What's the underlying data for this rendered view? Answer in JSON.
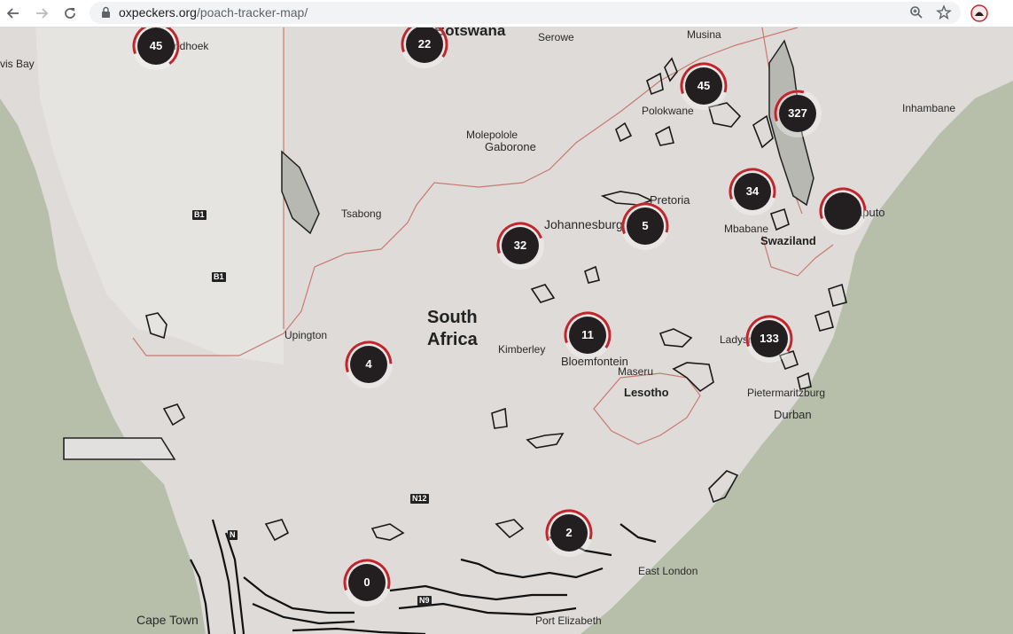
{
  "browser": {
    "url_domain": "oxpeckers.org",
    "url_path": "/poach-tracker-map/"
  },
  "map": {
    "colors": {
      "ocean": "#b7bfaa",
      "land": "#dedbd8",
      "land_light": "#eae8e6",
      "border": "#c87a72",
      "cluster_fill": "#231f20",
      "cluster_ring": "#c1262d"
    },
    "countries": [
      "South Africa",
      "Lesotho",
      "Swaziland"
    ],
    "cities": {
      "windhoek": "ndhoek",
      "walvis_bay": "vis Bay",
      "botswana": "Botswana",
      "serowe": "Serowe",
      "musina": "Musina",
      "polokwane": "Polokwane",
      "inhambane": "Inhambane",
      "molepolole": "Molepolole",
      "gaborone": "Gaborone",
      "tsabong": "Tsabong",
      "pretoria": "Pretoria",
      "johannesburg": "Johannesburg",
      "maputo": "aputo",
      "mbabane": "Mbabane",
      "upington": "Upington",
      "kimberley": "Kimberley",
      "bloemfontein": "Bloemfontein",
      "maseru": "Maseru",
      "ladysmith": "Ladysm",
      "pietermaritzburg": "Pietermaritzburg",
      "durban": "Durban",
      "east_london": "East London",
      "cape_town": "Cape Town",
      "port_elizabeth": "Port Elizabeth"
    },
    "roads": [
      "B1",
      "B1",
      "N12",
      "N",
      "N9"
    ],
    "clusters": [
      {
        "id": "windhoek",
        "count": "45",
        "progress": 0.7
      },
      {
        "id": "botswana",
        "count": "22",
        "progress": 0.65
      },
      {
        "id": "musina",
        "count": "45",
        "progress": 0.6
      },
      {
        "id": "kruger",
        "count": "327",
        "progress": 0.35
      },
      {
        "id": "mpumalanga",
        "count": "34",
        "progress": 0.6
      },
      {
        "id": "maputo",
        "count": "",
        "progress": 0.55
      },
      {
        "id": "johannesburg-east",
        "count": "5",
        "progress": 0.6
      },
      {
        "id": "johannesburg-west",
        "count": "32",
        "progress": 0.5
      },
      {
        "id": "free-state",
        "count": "11",
        "progress": 0.65
      },
      {
        "id": "kwazulu-natal",
        "count": "133",
        "progress": 0.65
      },
      {
        "id": "northern-cape",
        "count": "4",
        "progress": 0.55
      },
      {
        "id": "eastern-cape",
        "count": "2",
        "progress": 0.6
      },
      {
        "id": "western-cape",
        "count": "0",
        "progress": 0.6
      }
    ]
  }
}
